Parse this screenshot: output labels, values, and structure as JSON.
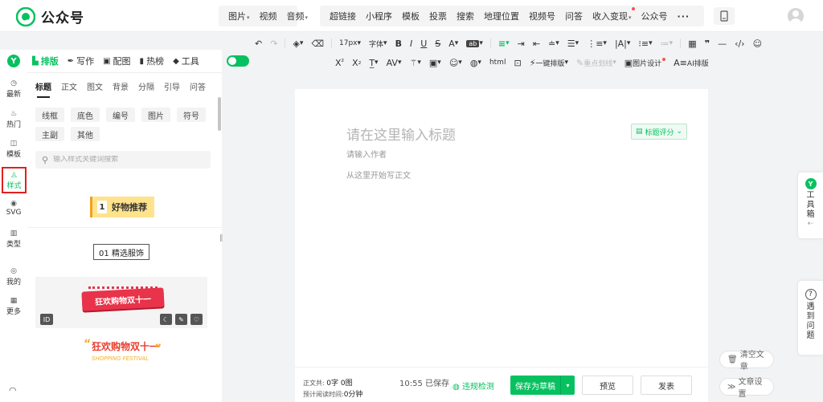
{
  "app": {
    "brand": "公众号",
    "accent": "#07c160"
  },
  "insert_menu": {
    "group1": [
      "图片",
      "视频",
      "音频"
    ],
    "group2": [
      "超链接",
      "小程序",
      "模板",
      "投票",
      "搜索",
      "地理位置",
      "视频号",
      "问答",
      "收入变现",
      "公众号"
    ],
    "more": "···"
  },
  "rail": {
    "items": [
      {
        "label": "最新",
        "icon": "clock-icon"
      },
      {
        "label": "热门",
        "icon": "flame-icon"
      },
      {
        "label": "模板",
        "icon": "template-icon"
      },
      {
        "label": "样式",
        "icon": "style-icon"
      },
      {
        "label": "SVG",
        "icon": "svg-icon"
      },
      {
        "label": "类型",
        "icon": "books-icon"
      },
      {
        "label": "我的",
        "icon": "user-icon"
      },
      {
        "label": "更多",
        "icon": "grid-icon"
      }
    ]
  },
  "tool_tabs": [
    {
      "label": "排版",
      "icon": "layout-icon"
    },
    {
      "label": "写作",
      "icon": "pen-icon"
    },
    {
      "label": "配图",
      "icon": "image-icon"
    },
    {
      "label": "热榜",
      "icon": "bookmark-icon"
    },
    {
      "label": "工具",
      "icon": "cube-icon"
    }
  ],
  "panel": {
    "subtabs": [
      "标题",
      "正文",
      "图文",
      "背景",
      "分隔",
      "引导",
      "问答"
    ],
    "chips": [
      "线框",
      "底色",
      "编号",
      "图片",
      "符号",
      "主副",
      "其他"
    ],
    "search_placeholder": "输入样式关键词搜索",
    "templates": {
      "t1_num": "1",
      "t1_text": "好物推荐",
      "t2_text": "01 精选服饰",
      "t3_text": "狂欢购物双十一",
      "t3_id": "ID",
      "t4_text": "狂欢购物双十一",
      "t4_sub": "SHOPPING FESTIVAL"
    }
  },
  "toolbar": {
    "font_size": "17px",
    "font_family": "字体",
    "row2_oneclick": "一键排版",
    "row2_divider": "重点划线",
    "row2_imgdesign": "图片设计",
    "row2_ai": "AI排版"
  },
  "editor": {
    "title_placeholder": "请在这里输入标题",
    "title_score": "标题评分",
    "author_placeholder": "请输入作者",
    "body_placeholder": "从这里开始写正文"
  },
  "footer": {
    "word_label": "正文共:",
    "word_value": "0字 0图",
    "read_label": "预计阅读时间:",
    "read_value": "0分钟",
    "save_time": "10:55  已保存",
    "check": "违规检测",
    "save_draft": "保存为草稿",
    "preview": "预览",
    "publish": "发表"
  },
  "right": {
    "toolbox": [
      "工",
      "具",
      "箱"
    ],
    "help": [
      "遇",
      "到",
      "问",
      "题"
    ],
    "clear": "清空文章",
    "settings": "文章设置"
  }
}
